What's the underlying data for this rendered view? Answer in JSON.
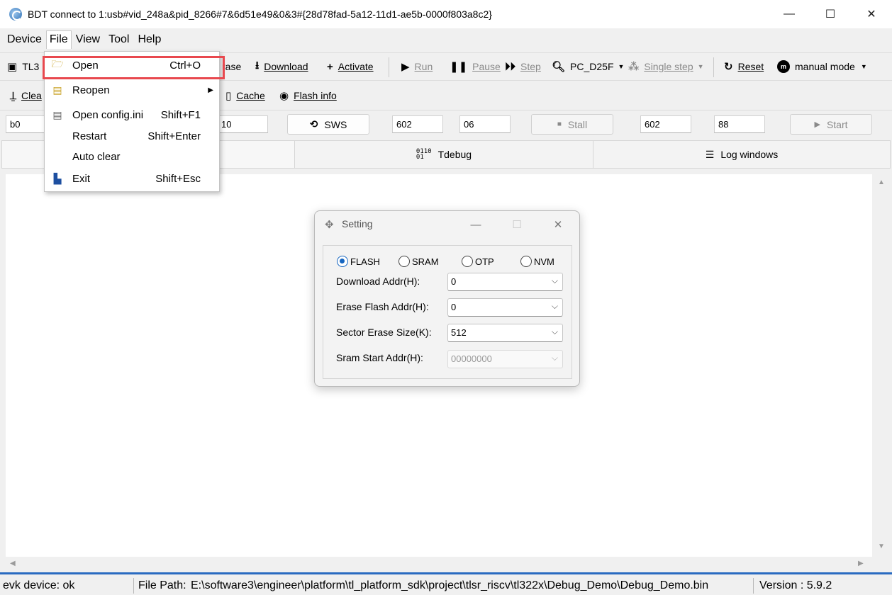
{
  "window": {
    "title": "BDT connect to 1:usb#vid_248a&pid_8266#7&6d51e49&0&3#{28d78fad-5a12-11d1-ae5b-0000f803a8c2}",
    "minimize": "—",
    "maximize": "☐",
    "close": "✕"
  },
  "menubar": [
    "Device",
    "File",
    "View",
    "Tool",
    "Help"
  ],
  "toolbar1": {
    "chip_label": "TL3",
    "erase": "rase",
    "download": "Download",
    "activate": "Activate",
    "run": "Run",
    "pause": "Pause",
    "step": "Step",
    "pc_label": "PC_D25F",
    "single_step": "Single step",
    "reset": "Reset",
    "mode": "manual mode"
  },
  "toolbar2": {
    "clear": "Clea",
    "cache": "Cache",
    "flash_info": "Flash info"
  },
  "inputs": {
    "field1": "b0",
    "field2": "10",
    "sws_button": "SWS",
    "field3": "602",
    "field4": "06",
    "stall_button": "Stall",
    "field5": "602",
    "field6": "88",
    "start_button": "Start"
  },
  "tabs": {
    "tdebug": "Tdebug",
    "log": "Log windows"
  },
  "file_menu": {
    "items": [
      {
        "label": "Open",
        "shortcut": "Ctrl+O",
        "icon": "folder-open-icon"
      },
      {
        "label": "Reopen",
        "shortcut": "",
        "icon": "reopen-icon"
      },
      {
        "label": "Open config.ini",
        "shortcut": "Shift+F1",
        "icon": "config-icon"
      },
      {
        "label": "Restart",
        "shortcut": "Shift+Enter",
        "icon": ""
      },
      {
        "label": "Auto clear",
        "shortcut": "",
        "icon": ""
      },
      {
        "label": "Exit",
        "shortcut": "Shift+Esc",
        "icon": "exit-icon"
      }
    ]
  },
  "dialog": {
    "title": "Setting",
    "radios": [
      "FLASH",
      "SRAM",
      "OTP",
      "NVM"
    ],
    "selected_radio": "FLASH",
    "fields": [
      {
        "label": "Download  Addr(H):",
        "value": "0"
      },
      {
        "label": "Erase Flash Addr(H):",
        "value": "0"
      },
      {
        "label": "Sector Erase Size(K):",
        "value": "512"
      },
      {
        "label": "Sram Start Addr(H):",
        "value": "00000000"
      }
    ]
  },
  "status": {
    "device": "evk device: ok",
    "file_path_label": "File Path:",
    "file_path": "E:\\software3\\engineer\\platform\\tl_platform_sdk\\project\\tlsr_riscv\\tl322x\\Debug_Demo\\Debug_Demo.bin",
    "version": "Version : 5.9.2"
  },
  "colors": {
    "highlight": "#e8484e",
    "accent": "#2a6bc1",
    "radio_selected": "#1565c0"
  }
}
